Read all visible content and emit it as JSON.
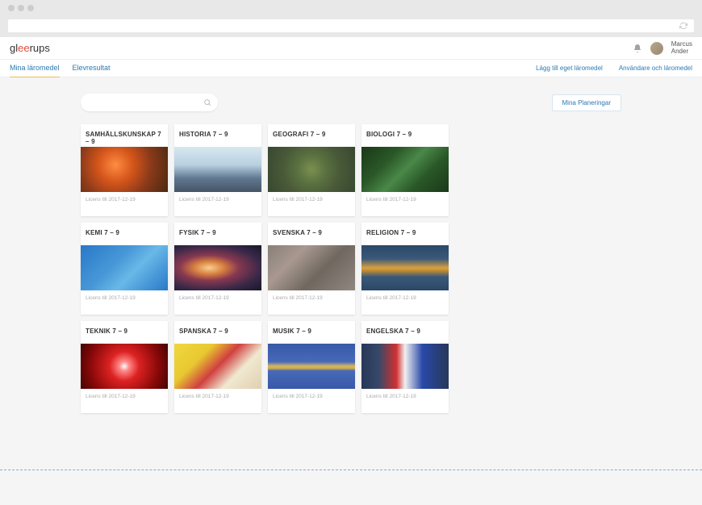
{
  "logo": {
    "part1": "gl",
    "accent": "ee",
    "part2": "rups"
  },
  "user": {
    "first": "Marcus",
    "last": "Ander"
  },
  "nav": {
    "tabs": [
      {
        "label": "Mina läromedel",
        "active": true
      },
      {
        "label": "Elevresultat",
        "active": false
      }
    ],
    "links": [
      {
        "label": "Lägg till eget läromedel"
      },
      {
        "label": "Användare och läromedel"
      }
    ]
  },
  "search": {
    "placeholder": ""
  },
  "plan_button": "Mina Planeringar",
  "license_prefix": "Licens till ",
  "cards": [
    {
      "title": "SAMHÄLLSKUNSKAP 7 – 9",
      "license": "2017-12-19",
      "img": "img-samh"
    },
    {
      "title": "HISTORIA 7 – 9",
      "license": "2017-12-19",
      "img": "img-hist"
    },
    {
      "title": "GEOGRAFI 7 – 9",
      "license": "2017-12-19",
      "img": "img-geo"
    },
    {
      "title": "BIOLOGI 7 – 9",
      "license": "2017-12-19",
      "img": "img-bio"
    },
    {
      "title": "KEMI 7 – 9",
      "license": "2017-12-19",
      "img": "img-kemi"
    },
    {
      "title": "FYSIK 7 – 9",
      "license": "2017-12-19",
      "img": "img-fysik"
    },
    {
      "title": "SVENSKA 7 – 9",
      "license": "2017-12-19",
      "img": "img-sven"
    },
    {
      "title": "RELIGION 7 – 9",
      "license": "2017-12-19",
      "img": "img-reli"
    },
    {
      "title": "TEKNIK 7 – 9",
      "license": "2017-12-19",
      "img": "img-tekn"
    },
    {
      "title": "SPANSKA 7 – 9",
      "license": "2017-12-19",
      "img": "img-span"
    },
    {
      "title": "MUSIK 7 – 9",
      "license": "2017-12-19",
      "img": "img-musik"
    },
    {
      "title": "ENGELSKA 7 – 9",
      "license": "2017-12-19",
      "img": "img-eng"
    }
  ]
}
